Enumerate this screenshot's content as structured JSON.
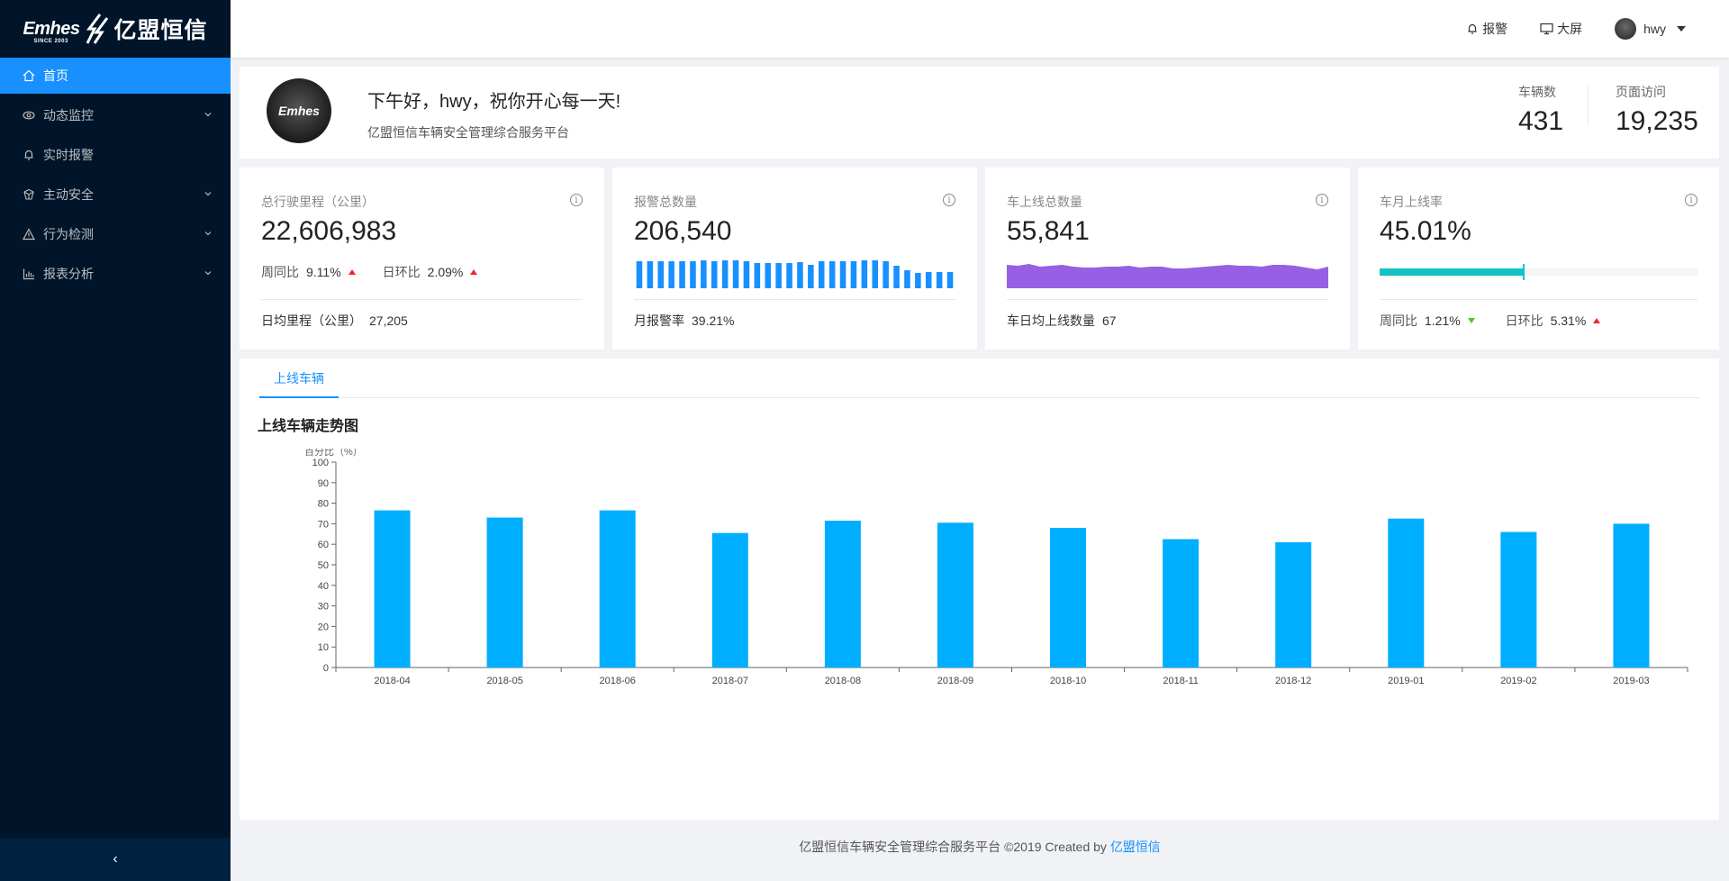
{
  "sidebar": {
    "logo_en": "Emhes",
    "logo_since": "SINCE 2003",
    "logo_cn": "亿盟恒信",
    "items": [
      {
        "label": "首页",
        "icon": "home-icon",
        "active": true
      },
      {
        "label": "动态监控",
        "icon": "eye-icon",
        "submenu": true
      },
      {
        "label": "实时报警",
        "icon": "bell-icon"
      },
      {
        "label": "主动安全",
        "icon": "shield-icon",
        "submenu": true
      },
      {
        "label": "行为检测",
        "icon": "warning-icon",
        "submenu": true
      },
      {
        "label": "报表分析",
        "icon": "bar-chart-icon",
        "submenu": true
      }
    ],
    "collapse_glyph": "‹"
  },
  "header": {
    "alarm_label": "报警",
    "screen_label": "大屏",
    "username": "hwy"
  },
  "welcome": {
    "greeting": "下午好，hwy，祝你开心每一天!",
    "subtitle": "亿盟恒信车辆安全管理综合服务平台",
    "avatar_text": "Emhes",
    "stats": [
      {
        "label": "车辆数",
        "value": "431"
      },
      {
        "label": "页面访问",
        "value": "19,235"
      }
    ]
  },
  "cards": [
    {
      "title": "总行驶里程（公里）",
      "value": "22,606,983",
      "trends": [
        {
          "label": "周同比",
          "value": "9.11%",
          "dir": "up"
        },
        {
          "label": "日环比",
          "value": "2.09%",
          "dir": "up"
        }
      ],
      "foot_label": "日均里程（公里）",
      "foot_value": "27,205"
    },
    {
      "title": "报警总数量",
      "value": "206,540",
      "foot_label": "月报警率",
      "foot_value": "39.21%",
      "mini_bars": [
        30,
        30,
        30,
        30,
        30,
        30,
        31,
        30,
        31,
        31,
        30,
        28,
        28,
        28,
        28,
        29,
        26,
        30,
        30,
        30,
        30,
        31,
        31,
        30,
        25,
        20,
        17,
        18,
        18,
        18
      ]
    },
    {
      "title": "车上线总数量",
      "value": "55,841",
      "foot_label": "车日均上线数量",
      "foot_value": "67",
      "mini_area": [
        26,
        25,
        27,
        24,
        25,
        26,
        24,
        23,
        23,
        24,
        24,
        25,
        23,
        24,
        24,
        22,
        22,
        23,
        24,
        25,
        26,
        25,
        25,
        24,
        26,
        26,
        25,
        23,
        21,
        24
      ]
    },
    {
      "title": "车月上线率",
      "value": "45.01%",
      "progress": 45.01,
      "trends": [
        {
          "label": "周同比",
          "value": "1.21%",
          "dir": "down"
        },
        {
          "label": "日环比",
          "value": "5.31%",
          "dir": "up"
        }
      ]
    }
  ],
  "chart_section": {
    "tab_label": "上线车辆",
    "title": "上线车辆走势图"
  },
  "chart_data": {
    "type": "bar",
    "ylabel": "百分比（%）",
    "ylim": [
      0,
      100
    ],
    "yticks": [
      0,
      10,
      20,
      30,
      40,
      50,
      60,
      70,
      80,
      90,
      100
    ],
    "categories": [
      "2018-04",
      "2018-05",
      "2018-06",
      "2018-07",
      "2018-08",
      "2018-09",
      "2018-10",
      "2018-11",
      "2018-12",
      "2019-01",
      "2019-02",
      "2019-03"
    ],
    "values": [
      76.5,
      73,
      76.5,
      65.5,
      71.5,
      70.5,
      68,
      62.5,
      61,
      72.5,
      66,
      70
    ],
    "color": "#00aeff"
  },
  "footer": {
    "text": "亿盟恒信车辆安全管理综合服务平台 ©2019 Created by",
    "link": "亿盟恒信"
  },
  "colors": {
    "sidebar": "#001529",
    "accent": "#1890ff",
    "bar_blue": "#1890ff",
    "area_purple": "#975fe4",
    "progress_teal": "#13c2c2",
    "up_red": "#f5222d",
    "down_green": "#52c41a"
  }
}
